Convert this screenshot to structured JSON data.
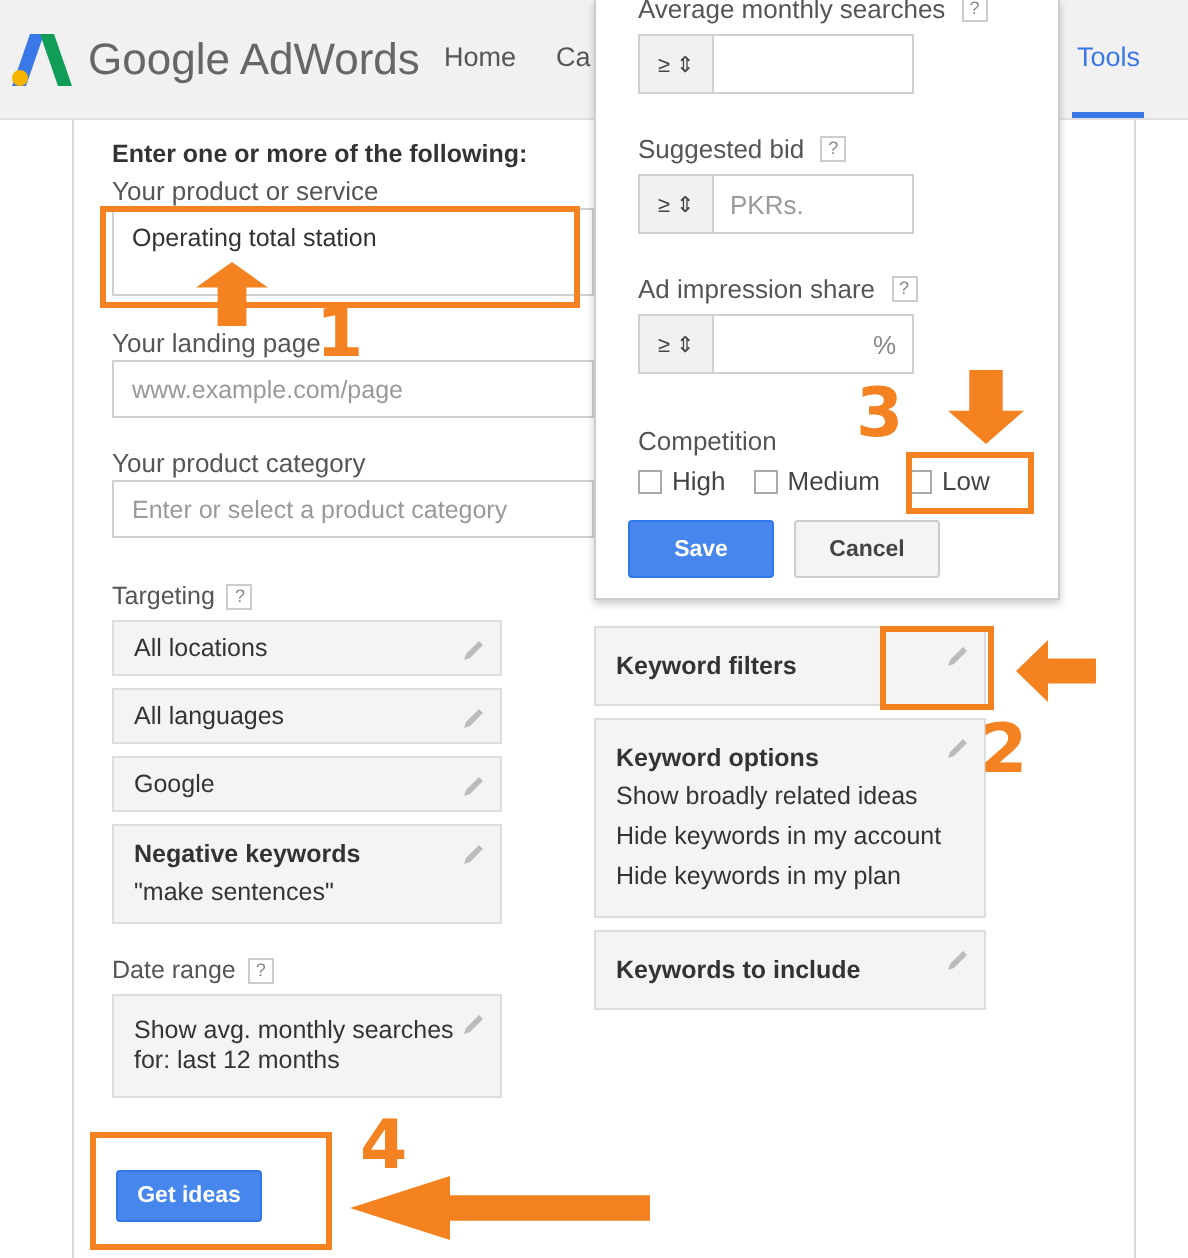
{
  "header": {
    "brand": "Google AdWords",
    "tabs": [
      {
        "label": "Home",
        "selected": false
      },
      {
        "label": "Ca",
        "selected": false
      },
      {
        "label": "Tools",
        "selected": true
      }
    ]
  },
  "form": {
    "heading": "Enter one or more of the following:",
    "fields": [
      {
        "label": "Your product or service",
        "kind": "textarea",
        "value": "Operating total station"
      },
      {
        "label": "Your landing page",
        "kind": "input",
        "placeholder": "www.example.com/page"
      },
      {
        "label": "Your product category",
        "kind": "input",
        "placeholder": "Enter or select a product category"
      }
    ],
    "targeting": {
      "label": "Targeting",
      "help": "?",
      "cards": [
        {
          "title": "All locations"
        },
        {
          "title": "All languages"
        },
        {
          "title": "Google"
        },
        {
          "title": "Negative keywords",
          "lines": [
            "\"make sentences\""
          ]
        }
      ]
    },
    "date_range": {
      "label": "Date range",
      "help": "?",
      "cards": [
        {
          "lines": [
            "Show avg. monthly searches",
            "for: last 12 months"
          ]
        }
      ]
    },
    "get_ideas": "Get ideas"
  },
  "options": [
    {
      "title": "Keyword filters"
    },
    {
      "title": "Keyword options",
      "lines": [
        "Show broadly related ideas",
        "Hide keywords in my account",
        "Hide keywords in my plan"
      ]
    },
    {
      "title": "Keywords to include"
    }
  ],
  "filter_popup": {
    "filters": [
      {
        "label": "Average monthly searches",
        "help": "?",
        "operator": "≥ ⇕"
      },
      {
        "label": "Suggested bid",
        "help": "?",
        "operator": "≥ ⇕",
        "placeholder": "PKRs."
      },
      {
        "label": "Ad impression share",
        "help": "?",
        "operator": "≥ ⇕",
        "suffix": "%"
      }
    ],
    "competition": {
      "label": "Competition",
      "options": [
        {
          "label": "High",
          "checked": false
        },
        {
          "label": "Medium",
          "checked": false
        },
        {
          "label": "Low",
          "checked": false
        }
      ]
    },
    "buttons": [
      {
        "label": "Save",
        "kind": "primary"
      },
      {
        "label": "Cancel",
        "kind": "secondary"
      }
    ]
  },
  "annotations": [
    {
      "label": "1"
    },
    {
      "label": "2"
    },
    {
      "label": "3"
    },
    {
      "label": "4"
    }
  ]
}
